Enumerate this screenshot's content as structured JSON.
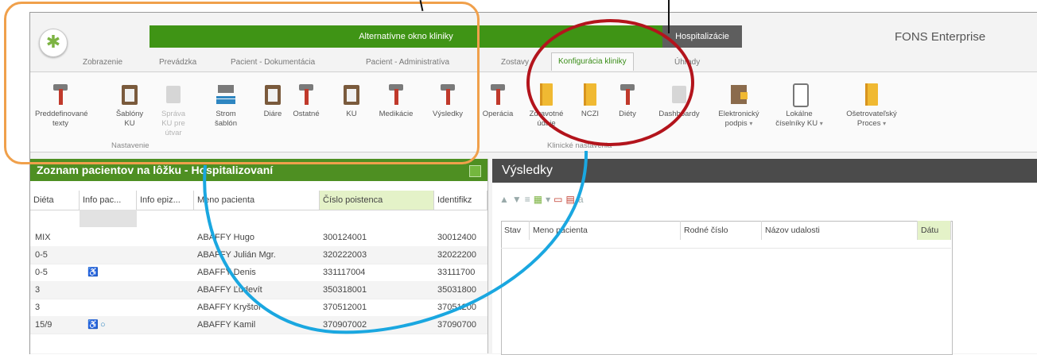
{
  "app": {
    "banner": "Alternatívne okno kliniky",
    "hospital_tab": "Hospitalizácie",
    "product": "FONS Enterprise"
  },
  "tabs": [
    "Zobrazenie",
    "Prevádzka",
    "Pacient - Dokumentácia",
    "Pacient - Administratíva",
    "Zostavy",
    "Konfigurácia kliniky",
    "Úhrady"
  ],
  "ribbon": {
    "buttons": [
      {
        "label": "Preddefinované texty"
      },
      {
        "label": "Šablóny KU"
      },
      {
        "label": "Správa KU pre útvar"
      },
      {
        "label": "Strom šablón"
      },
      {
        "label": "Diáre"
      },
      {
        "label": "Ostatné"
      },
      {
        "label": "KU"
      },
      {
        "label": "Medikácie"
      },
      {
        "label": "Výsledky"
      },
      {
        "label": "Operácia"
      },
      {
        "label": "Zdravotné údaje"
      },
      {
        "label": "NCZI"
      },
      {
        "label": "Diéty"
      },
      {
        "label": "Dashboardy"
      },
      {
        "label": "Elektronický podpis"
      },
      {
        "label": "Lokálne číselníky KU"
      },
      {
        "label": "Ošetrovateľský Proces"
      }
    ],
    "groups": [
      "Nastavenie",
      "Klinické nastavenia"
    ]
  },
  "left_panel": {
    "title": "Zoznam pacientov na lôžku - Hospitalizovaní",
    "columns": [
      "Diéta",
      "Info pac...",
      "Info epiz...",
      "Meno pacienta",
      "Číslo poistenca",
      "Identifikz"
    ],
    "rows": [
      {
        "dieta": "MIX",
        "meno": "ABAFFY Hugo",
        "cislo": "300124001",
        "ident": "30012400"
      },
      {
        "dieta": "0-5",
        "meno": "ABAFFY Julián Mgr.",
        "cislo": "320222003",
        "ident": "32022200"
      },
      {
        "dieta": "0-5",
        "meno": "ABAFFY Denis",
        "cislo": "331117004",
        "ident": "33111700"
      },
      {
        "dieta": "3",
        "meno": "ABAFFY Ľudevít",
        "cislo": "350318001",
        "ident": "35031800"
      },
      {
        "dieta": "3",
        "meno": "ABAFFY Kryštof",
        "cislo": "370512001",
        "ident": "37051200"
      },
      {
        "dieta": "15/9",
        "meno": "ABAFFY Kamil",
        "cislo": "370907002",
        "ident": "37090700"
      }
    ]
  },
  "right_panel": {
    "title": "Výsledky",
    "columns": [
      "Stav",
      "Meno pacienta",
      "Rodné číslo",
      "Názov udalosti",
      "Dátu"
    ]
  },
  "colors": {
    "green_band": "#3f9415",
    "header_green": "#4e8f22",
    "dark_header": "#4b4b4b",
    "annotation_orange": "#f0a04b",
    "annotation_red": "#b3141c",
    "annotation_blue": "#1aa7e0"
  }
}
